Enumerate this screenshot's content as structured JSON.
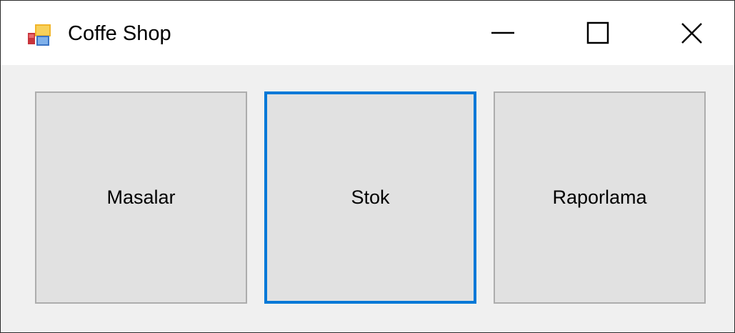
{
  "window": {
    "title": "Coffe Shop",
    "app_icon": "winforms-app-icon",
    "controls": {
      "minimize_icon": "minimize-icon",
      "maximize_icon": "maximize-icon",
      "close_icon": "close-icon"
    }
  },
  "buttons": [
    {
      "label": "Masalar",
      "focused": false
    },
    {
      "label": "Stok",
      "focused": true
    },
    {
      "label": "Raporlama",
      "focused": false
    }
  ],
  "colors": {
    "focus_border": "#0078d7",
    "button_face": "#e1e1e1",
    "button_border": "#adadad",
    "client_background": "#f0f0f0",
    "titlebar_background": "#ffffff"
  }
}
